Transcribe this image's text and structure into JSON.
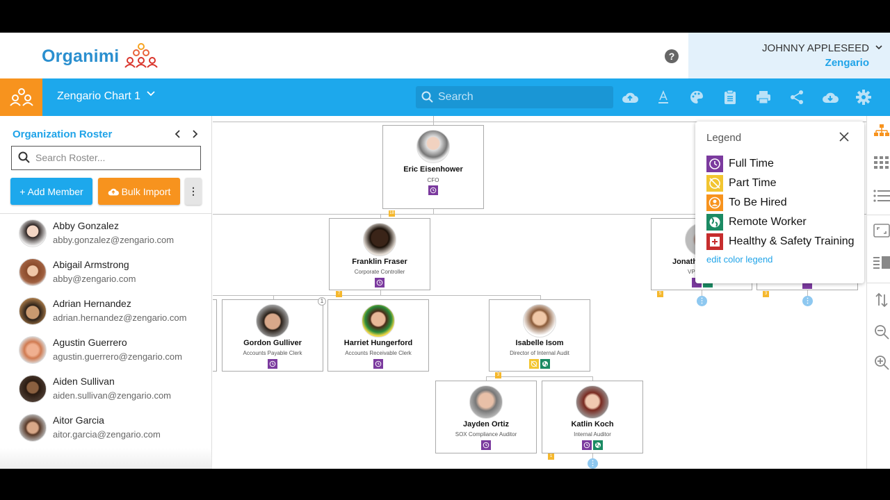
{
  "header": {
    "logo_text": "Organimi",
    "help_label": "?",
    "user_name": "JOHNNY APPLESEED",
    "org_name": "Zengario"
  },
  "toolbar": {
    "chart_title": "Zengario Chart 1",
    "search_placeholder": "Search",
    "icons": [
      "upload-cloud-icon",
      "text-format-icon",
      "palette-icon",
      "clipboard-icon",
      "print-icon",
      "share-icon",
      "download-cloud-icon",
      "settings-gear-icon"
    ]
  },
  "roster": {
    "title": "Organization Roster",
    "search_placeholder": "Search Roster...",
    "add_member_label": "+ Add Member",
    "bulk_import_label": "Bulk Import",
    "more_label": "⋮",
    "members": [
      {
        "name": "Abby Gonzalez",
        "email": "abby.gonzalez@zengario.com"
      },
      {
        "name": "Abigail Armstrong",
        "email": "abby@zengario.com"
      },
      {
        "name": "Adrian Hernandez",
        "email": "adrian.hernandez@zengario.com"
      },
      {
        "name": "Agustin Guerrero",
        "email": "agustin.guerrero@zengario.com"
      },
      {
        "name": "Aiden Sullivan",
        "email": "aiden.sullivan@zengario.com"
      },
      {
        "name": "Aitor Garcia",
        "email": "aitor.garcia@zengario.com"
      }
    ]
  },
  "chart": {
    "nodes": [
      {
        "name": "Eric Eisenhower",
        "title": "CFO",
        "badges": [
          "full-time"
        ],
        "reports": "18"
      },
      {
        "name": "Franklin Fraser",
        "title": "Corporate Controller",
        "badges": [
          "full-time"
        ],
        "reports": "7"
      },
      {
        "name": "Gordon Gulliver",
        "title": "Accounts Payable Clerk",
        "badges": [
          "full-time"
        ],
        "comments": "1"
      },
      {
        "name": "Harriet Hungerford",
        "title": "Accounts Receivable Clerk",
        "badges": [
          "full-time"
        ]
      },
      {
        "name": "Isabelle Isom",
        "title": "Director of Internal Audit",
        "badges": [
          "part-time",
          "remote-worker"
        ],
        "reports": "3"
      },
      {
        "name": "Jayden Ortiz",
        "title": "SOX Compliance Auditor",
        "badges": [
          "full-time"
        ]
      },
      {
        "name": "Katlin Koch",
        "title": "Internal Auditor",
        "badges": [
          "full-time",
          "remote-worker"
        ],
        "reports": "1"
      },
      {
        "name": "Jonath",
        "title": "VP",
        "badges": [
          "full-time",
          "remote-worker"
        ],
        "reports": "5"
      },
      {
        "name": "",
        "title": "",
        "badges": [
          "full-time"
        ],
        "reports": "3"
      }
    ],
    "expand_label": "⋮"
  },
  "legend": {
    "title": "Legend",
    "items": [
      {
        "label": "Full Time",
        "color": "#7b3a9e",
        "icon": "clock-icon"
      },
      {
        "label": "Part Time",
        "color": "#f2c530",
        "icon": "clock-off-icon"
      },
      {
        "label": "To Be Hired",
        "color": "#f7931e",
        "icon": "person-icon"
      },
      {
        "label": "Remote Worker",
        "color": "#1b8a63",
        "icon": "globe-icon"
      },
      {
        "label": "Healthy & Safety Training",
        "color": "#c62d2d",
        "icon": "plus-box-icon"
      }
    ],
    "edit_label": "edit color legend"
  },
  "colors": {
    "brand_blue": "#1da8ec",
    "brand_orange": "#f7931e",
    "full_time": "#7b3a9e",
    "part_time": "#f2c530",
    "remote": "#1b8a63"
  }
}
